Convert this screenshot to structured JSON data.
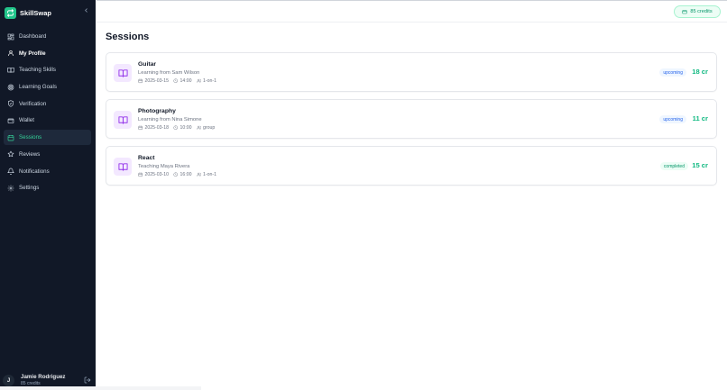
{
  "app": {
    "name": "SkillSwap"
  },
  "sidebar": {
    "items": [
      {
        "label": "Dashboard",
        "icon": "dashboard-icon"
      },
      {
        "label": "My Profile",
        "icon": "user-icon"
      },
      {
        "label": "Teaching Skills",
        "icon": "book-icon"
      },
      {
        "label": "Learning Goals",
        "icon": "target-icon"
      },
      {
        "label": "Verification",
        "icon": "shield-icon"
      },
      {
        "label": "Wallet",
        "icon": "wallet-icon"
      },
      {
        "label": "Sessions",
        "icon": "calendar-icon"
      },
      {
        "label": "Reviews",
        "icon": "star-icon"
      },
      {
        "label": "Notifications",
        "icon": "bell-icon"
      },
      {
        "label": "Settings",
        "icon": "gear-icon"
      }
    ],
    "active_item": "Sessions"
  },
  "user": {
    "initial": "J",
    "name": "Jamie Rodriguez",
    "credits": "85 credits"
  },
  "header": {
    "credits": "85 credits"
  },
  "page": {
    "title": "Sessions"
  },
  "sessions": [
    {
      "title": "Guitar",
      "subtitle": "Learning from Sam Wilson",
      "date": "2025-03-15",
      "time": "14:00",
      "format": "1-on-1",
      "status": "upcoming",
      "credits": "18 cr"
    },
    {
      "title": "Photography",
      "subtitle": "Learning from Nina Simone",
      "date": "2025-03-18",
      "time": "10:00",
      "format": "group",
      "status": "upcoming",
      "credits": "11 cr"
    },
    {
      "title": "React",
      "subtitle": "Teaching Maya Rivera",
      "date": "2025-03-10",
      "time": "16:00",
      "format": "1-on-1",
      "status": "completed",
      "credits": "15 cr"
    }
  ],
  "colors": {
    "sidebar_bg": "#111827",
    "accent": "#10b981",
    "active_text": "#34d399",
    "upcoming": "#2563eb",
    "completed": "#059669",
    "session_icon_bg": "#f3e8ff",
    "session_icon": "#9333ea"
  }
}
